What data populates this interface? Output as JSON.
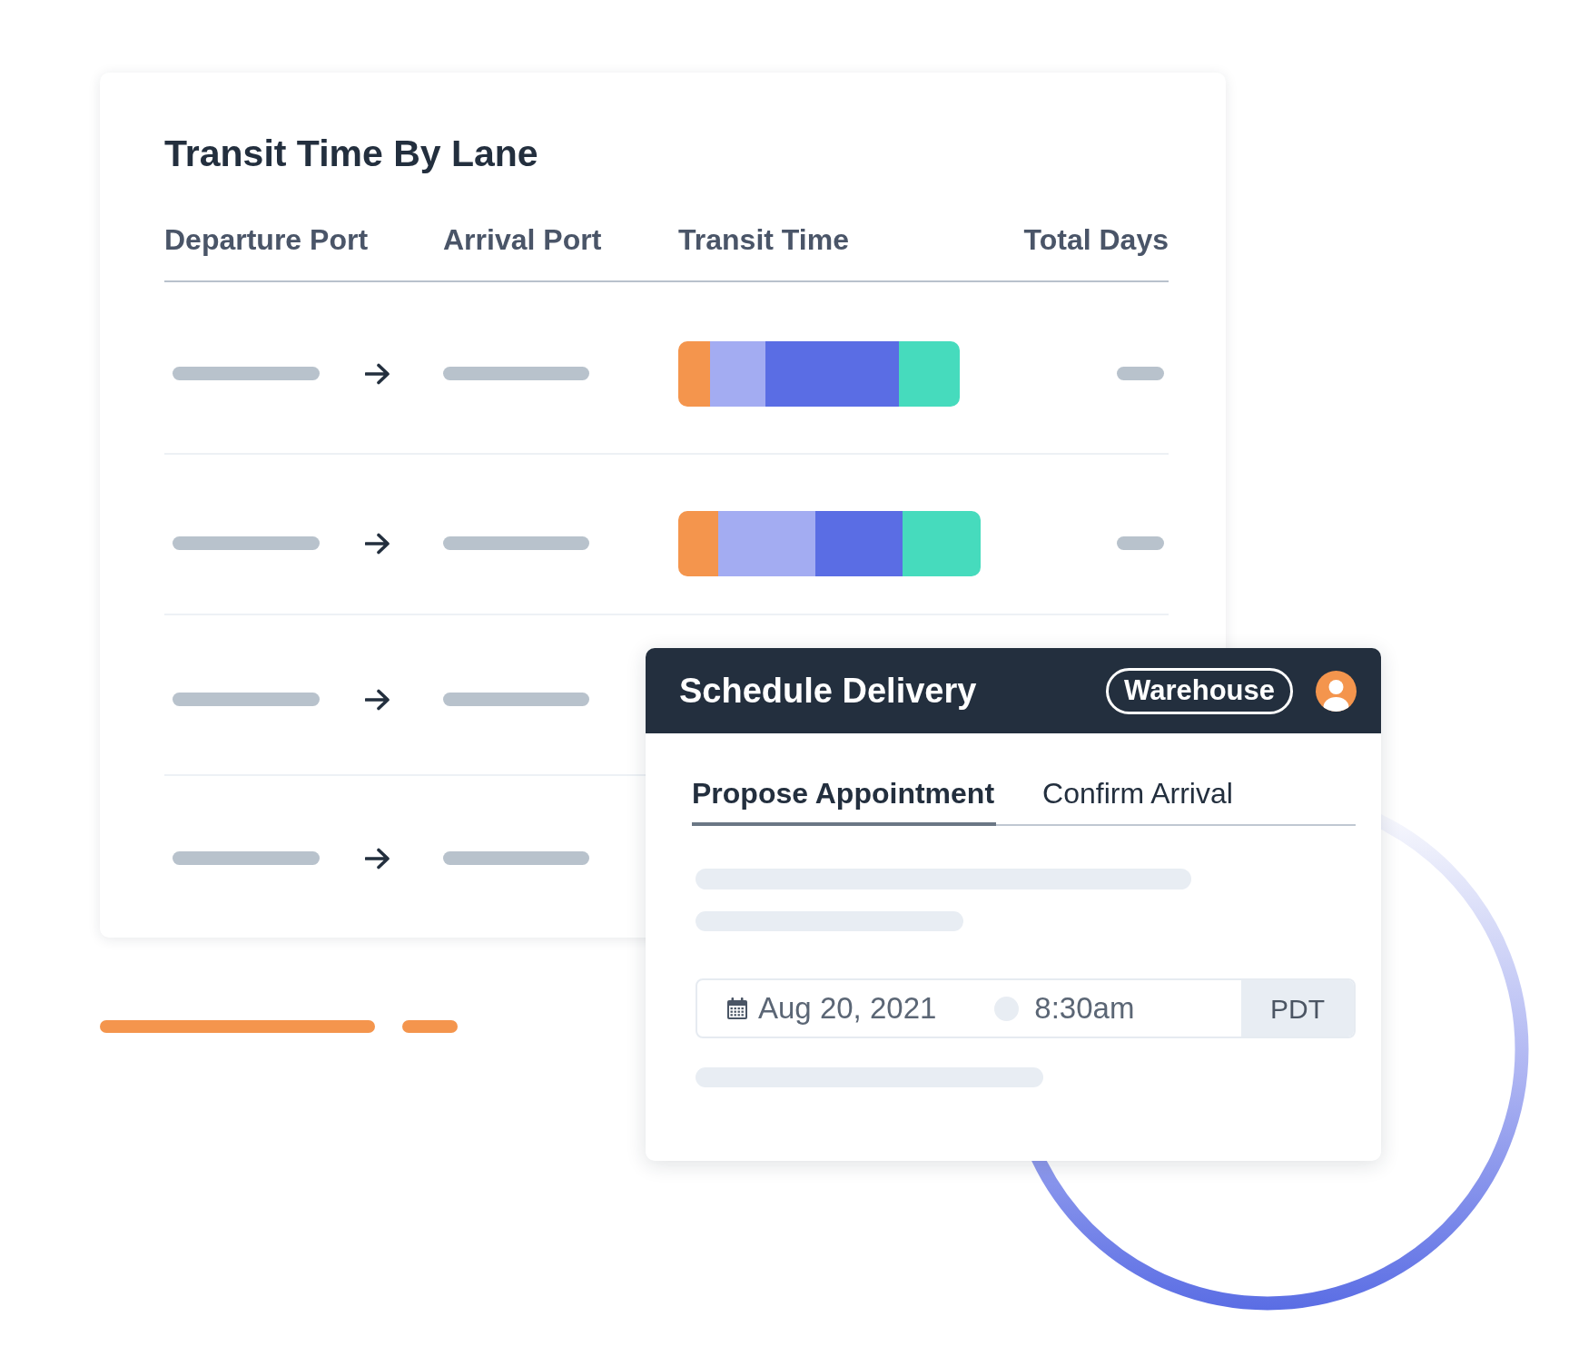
{
  "lane_table": {
    "title": "Transit Time By Lane",
    "columns": [
      "Departure Port",
      "Arrival Port",
      "Transit Time",
      "Total Days"
    ],
    "rows": [
      {
        "kind": "complete",
        "segments": [
          {
            "color": "#f4954d"
          },
          {
            "color": "#a3acf2"
          },
          {
            "color": "#5a6de4"
          },
          {
            "color": "#46dbbd"
          }
        ]
      },
      {
        "kind": "complete",
        "segments": [
          {
            "color": "#f4954d"
          },
          {
            "color": "#a3acf2"
          },
          {
            "color": "#5a6de4"
          },
          {
            "color": "#46dbbd"
          }
        ]
      },
      {
        "kind": "covered"
      },
      {
        "kind": "covered"
      }
    ]
  },
  "schedule_dialog": {
    "title": "Schedule Delivery",
    "role_badge": "Warehouse",
    "tabs": [
      {
        "label": "Propose Appointment",
        "selected": true
      },
      {
        "label": "Confirm Arrival",
        "selected": false
      }
    ],
    "appointment": {
      "date": "Aug 20, 2021",
      "time": "8:30am",
      "timezone": "PDT"
    }
  }
}
